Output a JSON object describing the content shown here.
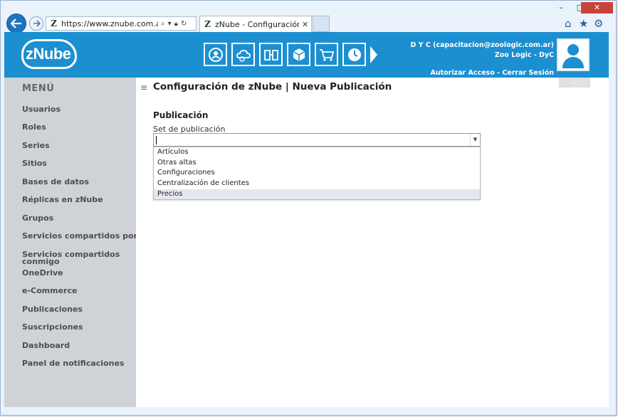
{
  "browser": {
    "url_prefix": "https://www.",
    "url_rest": "znube.com.ar/Pub",
    "tab_title": "zNube - Configuración de z...",
    "window_controls": {
      "minimize": "–",
      "restore": "□",
      "close": "✕"
    },
    "icons": [
      "back-arrow-icon",
      "forward-arrow-icon",
      "search-icon",
      "lock-icon",
      "refresh-icon",
      "home-icon",
      "star-icon",
      "gear-icon"
    ]
  },
  "header": {
    "logo_text": "zNube",
    "modules": [
      "sync-users-icon",
      "cloud-settings-icon",
      "replicas-icon",
      "package-icon",
      "cart-icon",
      "clock-icon"
    ],
    "user_line1": "D Y C (capacitacion@zoologic.com.ar)",
    "user_line2": "Zoo Logic - DyC",
    "authorize_link": "Autorizar Acceso",
    "separator": "-",
    "logout_link": "Cerrar Sesión"
  },
  "sidebar": {
    "title": "MENÚ",
    "items": [
      {
        "label": "Usuarios"
      },
      {
        "label": "Roles"
      },
      {
        "label": "Series"
      },
      {
        "label": "Sitios"
      },
      {
        "label": "Bases de datos"
      },
      {
        "label": "Réplicas en zNube"
      },
      {
        "label": "Grupos"
      },
      {
        "label": "Servicios compartidos por mi"
      },
      {
        "label": "Servicios compartidos conmigo"
      },
      {
        "label": "OneDrive"
      },
      {
        "label": "e-Commerce"
      },
      {
        "label": "Publicaciones"
      },
      {
        "label": "Suscripciones"
      },
      {
        "label": "Dashboard"
      },
      {
        "label": "Panel de notificaciones"
      }
    ]
  },
  "main": {
    "title": "Configuración de zNube | Nueva Publicación",
    "section_title": "Publicación",
    "field_label": "Set de publicación",
    "select_value": "",
    "options": [
      "Artículos",
      "Otras altas",
      "Configuraciones",
      "Centralización de clientes",
      "Precios"
    ],
    "hovered_option": "Precios"
  },
  "colors": {
    "header_bg": "#1c8fd0",
    "sidebar_bg": "#cfd2d6",
    "window_chrome": "#eaf2fb",
    "close_button": "#c7433a"
  }
}
